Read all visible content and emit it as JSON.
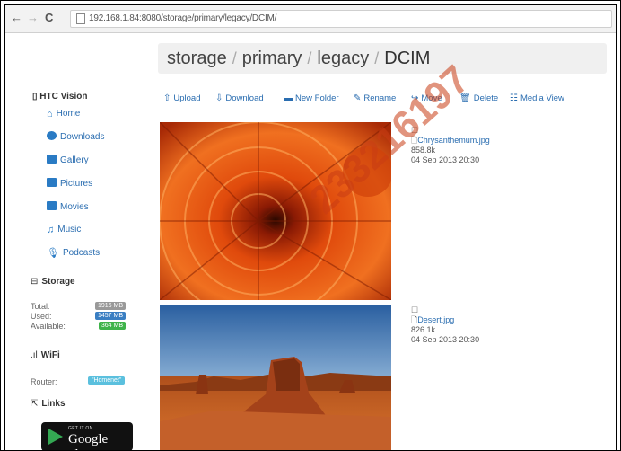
{
  "browser": {
    "back_glyph": "←",
    "forward_glyph": "→",
    "reload_glyph": "C",
    "url": "192.168.1.84:8080/storage/primary/legacy/DCIM/"
  },
  "breadcrumb": [
    "storage",
    "primary",
    "legacy",
    "DCIM"
  ],
  "breadcrumb_separator": "/",
  "sidebar": {
    "brand": "HTC Vision",
    "items": [
      {
        "label": "Home",
        "icon": "home-icon"
      },
      {
        "label": "Downloads",
        "icon": "download-icon"
      },
      {
        "label": "Gallery",
        "icon": "gallery-icon"
      },
      {
        "label": "Pictures",
        "icon": "camera-icon"
      },
      {
        "label": "Movies",
        "icon": "video-icon"
      },
      {
        "label": "Music",
        "icon": "music-icon"
      },
      {
        "label": "Podcasts",
        "icon": "microphone-icon"
      }
    ],
    "storage": {
      "title": "Storage",
      "rows": [
        {
          "label": "Total:",
          "value": "1916 MB"
        },
        {
          "label": "Used:",
          "value": "1457 MB"
        },
        {
          "label": "Available:",
          "value": "364 MB"
        }
      ]
    },
    "wifi": {
      "title": "WiFi",
      "label": "Router:",
      "value": "\"Homenet\""
    },
    "links": {
      "title": "Links"
    },
    "store_badge": {
      "small": "GET IT ON",
      "big": "Google play"
    }
  },
  "toolbar": {
    "upload": "Upload",
    "download": "Download",
    "new_folder": "New Folder",
    "rename": "Rename",
    "move": "Move",
    "delete": "Delete",
    "media_view": "Media View"
  },
  "files": [
    {
      "name": "Chrysanthemum.jpg",
      "size": "858.8k",
      "date": "04 Sep 2013 20:30"
    },
    {
      "name": "Desert.jpg",
      "size": "826.1k",
      "date": "04 Sep 2013 20:30"
    }
  ],
  "watermark": "233216197",
  "colors": {
    "link": "#2a6db0",
    "used": "#3a7ec2",
    "available": "#3fb34a",
    "wifi": "#5bc0de",
    "watermark": "#c83c14"
  }
}
